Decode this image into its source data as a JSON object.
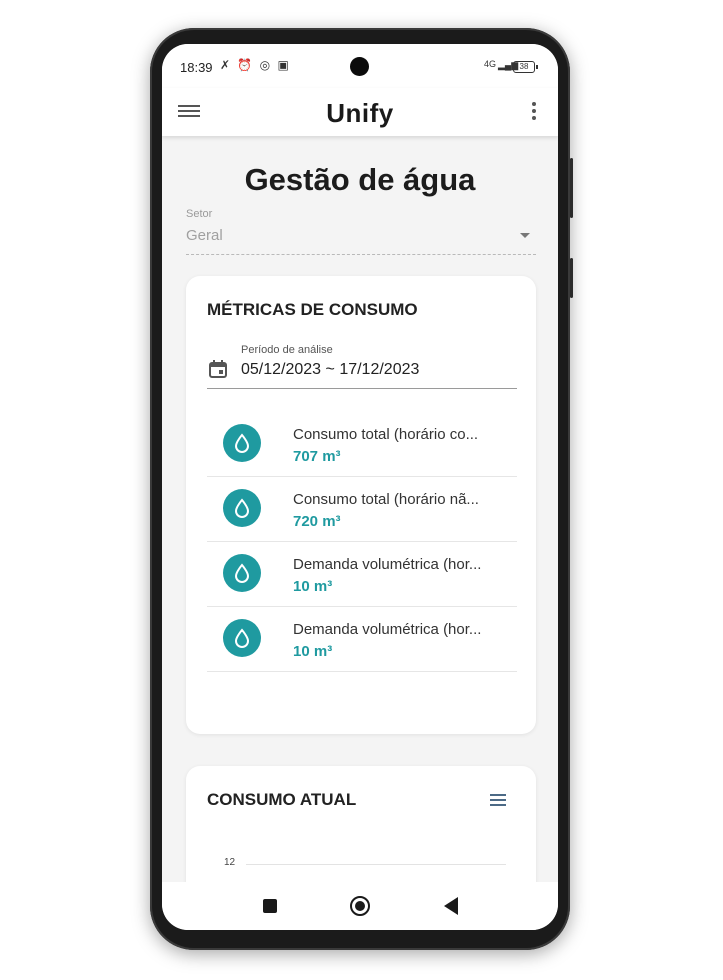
{
  "status_bar": {
    "time": "18:39",
    "network": "4G",
    "battery": "38"
  },
  "app_bar": {
    "logo": "Unify"
  },
  "page": {
    "title": "Gestão de água"
  },
  "sector_select": {
    "label": "Setor",
    "value": "Geral"
  },
  "metrics_card": {
    "title": "MÉTRICAS DE CONSUMO",
    "period_label": "Período de análise",
    "period_value": "05/12/2023 ~ 17/12/2023",
    "items": [
      {
        "label": "Consumo total (horário co...",
        "value": "707 m³",
        "icon": "water-drop-icon"
      },
      {
        "label": "Consumo total (horário nã...",
        "value": "720 m³",
        "icon": "water-drop-icon"
      },
      {
        "label": "Demanda volumétrica (hor...",
        "value": "10 m³",
        "icon": "water-drop-icon"
      },
      {
        "label": "Demanda volumétrica (hor...",
        "value": "10 m³",
        "icon": "water-drop-icon"
      }
    ]
  },
  "current_card": {
    "title": "CONSUMO ATUAL",
    "y_tick": "12"
  },
  "colors": {
    "accent": "#1f9aa0",
    "background": "#f4f4f4",
    "card": "#ffffff"
  }
}
